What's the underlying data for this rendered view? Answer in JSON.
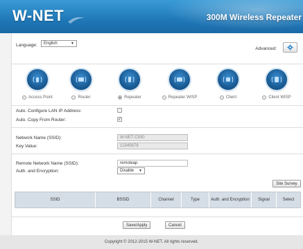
{
  "header": {
    "logo": "W-NET",
    "title": "300M Wireless Repeater"
  },
  "language": {
    "label": "Language:",
    "value": "English"
  },
  "advanced": {
    "label": "Advanced:",
    "icon": "gear-icon"
  },
  "modes": [
    {
      "label": "Access Point",
      "icon": "access-point-icon",
      "selected": false
    },
    {
      "label": "Router",
      "icon": "router-icon",
      "selected": false
    },
    {
      "label": "Repeater",
      "icon": "repeater-icon",
      "selected": true
    },
    {
      "label": "Repeater WISP",
      "icon": "repeater-wisp-icon",
      "selected": false
    },
    {
      "label": "Client",
      "icon": "client-icon",
      "selected": false
    },
    {
      "label": "Client WISP",
      "icon": "client-wisp-icon",
      "selected": false
    }
  ],
  "options": {
    "auto_configure_label": "Auto. Configure LAN IP Address:",
    "auto_configure_checked": false,
    "auto_copy_label": "Auto. Copy From Router:",
    "auto_copy_checked": true
  },
  "network": {
    "ssid_label": "Network Name (SSID):",
    "ssid_value": "W-NET-C930",
    "key_label": "Key Value:",
    "key_value": "12345678"
  },
  "remote": {
    "ssid_label": "Remote Network Name (SSID):",
    "ssid_value": "remoteap",
    "auth_label": "Auth. and Encryption:",
    "auth_value": "Disable",
    "site_survey_label": "Site Survey"
  },
  "table": {
    "columns": [
      "SSID",
      "BSSID",
      "Channel",
      "Type",
      "Auth. and Encryption",
      "Signal",
      "Select"
    ]
  },
  "actions": {
    "save_label": "Save/Apply",
    "cancel_label": "Cancel"
  },
  "footer": {
    "copyright": "Copyright © 2012-2015 W-NET. All rights reserved."
  },
  "colors": {
    "header_blue": "#2482c4",
    "icon_blue": "#1c5f99"
  }
}
